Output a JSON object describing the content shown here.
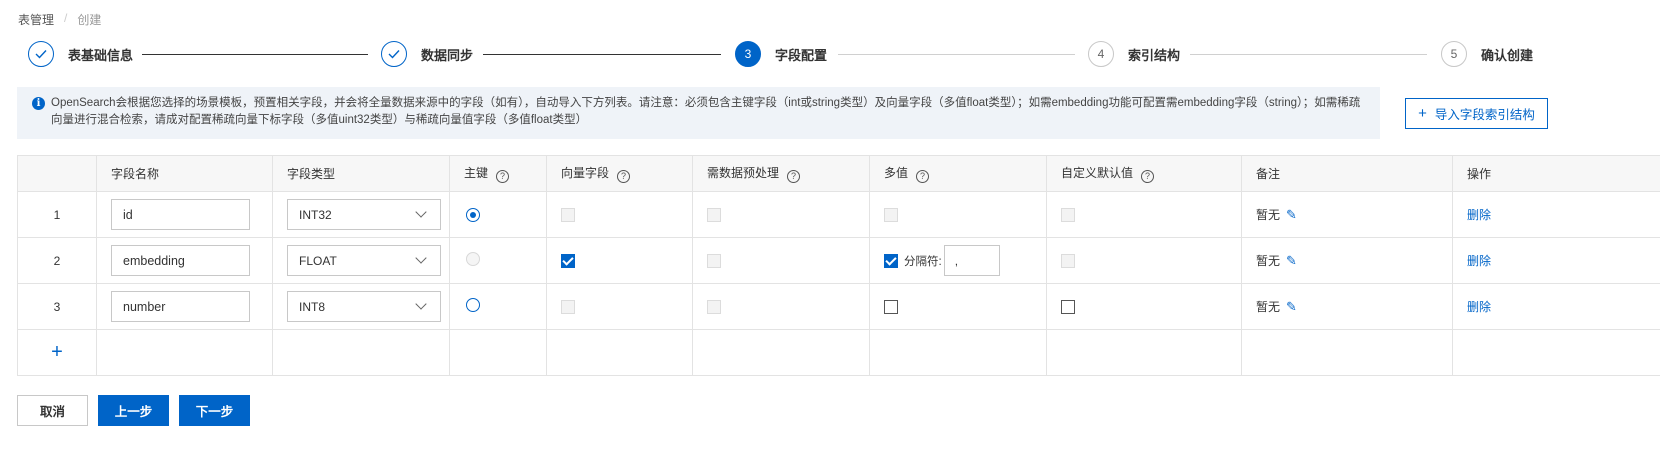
{
  "breadcrumb": {
    "root": "表管理",
    "separator": "/",
    "current": "创建"
  },
  "steps": [
    {
      "num": "1",
      "label": "表基础信息",
      "status": "done"
    },
    {
      "num": "2",
      "label": "数据同步",
      "status": "done"
    },
    {
      "num": "3",
      "label": "字段配置",
      "status": "active"
    },
    {
      "num": "4",
      "label": "索引结构",
      "status": "todo"
    },
    {
      "num": "5",
      "label": "确认创建",
      "status": "todo"
    }
  ],
  "notice": {
    "text": "OpenSearch会根据您选择的场景模板，预置相关字段，并会将全量数据来源中的字段（如有），自动导入下方列表。请注意：必须包含主键字段（int或string类型）及向量字段（多值float类型）；如需embedding功能可配置需embedding字段（string）；如需稀疏向量进行混合检索，请成对配置稀疏向量下标字段（多值uint32类型）与稀疏向量值字段（多值float类型）"
  },
  "import_button": {
    "label": "导入字段索引结构"
  },
  "table": {
    "headers": {
      "name": "字段名称",
      "type": "字段类型",
      "pk": "主键",
      "vector": "向量字段",
      "preprocess": "需数据预处理",
      "multi": "多值",
      "default": "自定义默认值",
      "remark": "备注",
      "action": "操作"
    },
    "rows": [
      {
        "index": "1",
        "name": "id",
        "type": "INT32",
        "remark": "暂无",
        "action": "删除"
      },
      {
        "index": "2",
        "name": "embedding",
        "type": "FLOAT",
        "separator_label": "分隔符:",
        "separator_value": ",",
        "remark": "暂无",
        "action": "删除"
      },
      {
        "index": "3",
        "name": "number",
        "type": "INT8",
        "remark": "暂无",
        "action": "删除"
      }
    ],
    "help_glyph": "?",
    "add_glyph": "+"
  },
  "footer": {
    "cancel": "取消",
    "prev": "上一步",
    "next": "下一步"
  },
  "colors": {
    "primary": "#0064c8",
    "notice_bg": "#eff3f8"
  }
}
